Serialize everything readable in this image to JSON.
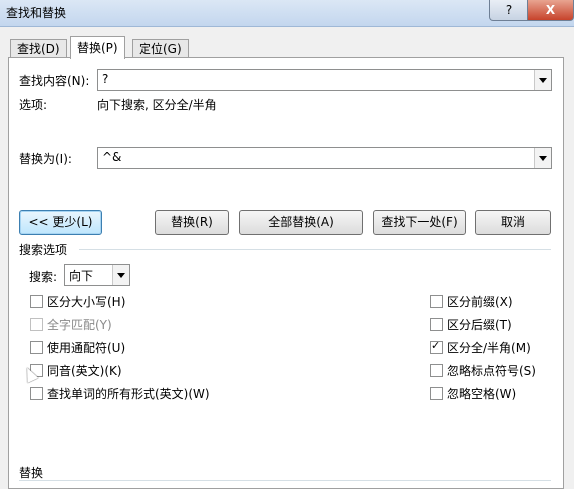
{
  "window": {
    "title": "查找和替换",
    "help_label": "?",
    "close_label": "X"
  },
  "tabs": [
    {
      "label": "查找(D)",
      "active": false
    },
    {
      "label": "替换(P)",
      "active": true
    },
    {
      "label": "定位(G)",
      "active": false
    }
  ],
  "find": {
    "label": "查找内容(N):",
    "value": "?",
    "options_label": "选项:",
    "options_value": "向下搜索, 区分全/半角"
  },
  "replace": {
    "label": "替换为(I):",
    "value": "^&"
  },
  "buttons": {
    "less": "<< 更少(L)",
    "replace": "替换(R)",
    "replace_all": "全部替换(A)",
    "find_next": "查找下一处(F)",
    "cancel": "取消"
  },
  "search_options": {
    "heading": "搜索选项",
    "direction_label": "搜索:",
    "direction_value": "向下"
  },
  "checkboxes_left": [
    {
      "label": "区分大小写(H)",
      "checked": false,
      "disabled": false
    },
    {
      "label": "全字匹配(Y)",
      "checked": false,
      "disabled": true
    },
    {
      "label": "使用通配符(U)",
      "checked": false,
      "disabled": false
    },
    {
      "label": "同音(英文)(K)",
      "checked": false,
      "disabled": false
    },
    {
      "label": "查找单词的所有形式(英文)(W)",
      "checked": false,
      "disabled": false
    }
  ],
  "checkboxes_right": [
    {
      "label": "区分前缀(X)",
      "checked": false,
      "disabled": false
    },
    {
      "label": "区分后缀(T)",
      "checked": false,
      "disabled": false
    },
    {
      "label": "区分全/半角(M)",
      "checked": true,
      "disabled": false
    },
    {
      "label": "忽略标点符号(S)",
      "checked": false,
      "disabled": false
    },
    {
      "label": "忽略空格(W)",
      "checked": false,
      "disabled": false
    }
  ],
  "replace_section": {
    "heading": "替换"
  }
}
